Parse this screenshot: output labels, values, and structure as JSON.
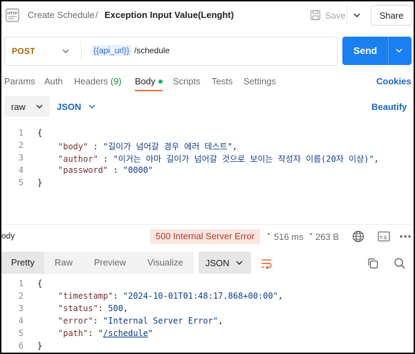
{
  "titlebar": {
    "icon_name": "http-icon",
    "breadcrumb_parent": "Create Schedule",
    "breadcrumb_sep": "/",
    "title": "Exception Input Value(Lenght)",
    "save_label": "Save",
    "share_label": "Share"
  },
  "request": {
    "method": "POST",
    "url_variable": "{{api_url}}",
    "url_path": "/schedule",
    "send_label": "Send"
  },
  "request_tabs": {
    "params": "Params",
    "auth": "Auth",
    "headers": "Headers",
    "headers_count": "(9)",
    "body": "Body",
    "scripts": "Scripts",
    "tests": "Tests",
    "settings": "Settings",
    "cookies": "Cookies"
  },
  "body_options": {
    "mode": "raw",
    "format": "JSON",
    "beautify": "Beautify"
  },
  "request_body": {
    "line_numbers": [
      "1",
      "2",
      "3",
      "4",
      "5"
    ],
    "lines": [
      {
        "open": "{"
      },
      {
        "key": "\"body\"",
        "sep": " : ",
        "value": "\"길이가 넘어갈 경우 에러 테스트\"",
        "end": ","
      },
      {
        "key": "\"author\"",
        "sep": " : ",
        "value": "\"이거는 아마 길이가 넘어갈 것으로 보이는 작성자 이름(20자 이상)\"",
        "end": ","
      },
      {
        "key": "\"password\"",
        "sep": " : ",
        "value": "\"0000\"",
        "end": ""
      },
      {
        "close": "}"
      }
    ]
  },
  "response": {
    "body_label": "ody",
    "status": "500 Internal Server Error",
    "time": "516 ms",
    "size": "263 B",
    "status_color": "#b13a20",
    "tabs": {
      "pretty": "Pretty",
      "raw": "Raw",
      "preview": "Preview",
      "visualize": "Visualize"
    },
    "format": "JSON"
  },
  "response_body": {
    "line_numbers": [
      "1",
      "2",
      "3",
      "4",
      "5",
      "6"
    ],
    "open": "{",
    "timestamp_key": "\"timestamp\"",
    "timestamp_value": "\"2024-10-01T01:48:17.868+00:00\"",
    "status_key": "\"status\"",
    "status_value": "500",
    "error_key": "\"error\"",
    "error_value": "\"Internal Server Error\"",
    "path_key": "\"path\"",
    "path_quote_open": "\"",
    "path_value": "/schedule",
    "path_quote_close": "\"",
    "close": "}"
  },
  "colors": {
    "send_button": "#1a7ff0",
    "method": "#a06a00",
    "tab_underline": "#f26b3a",
    "link": "#1a66c9"
  }
}
